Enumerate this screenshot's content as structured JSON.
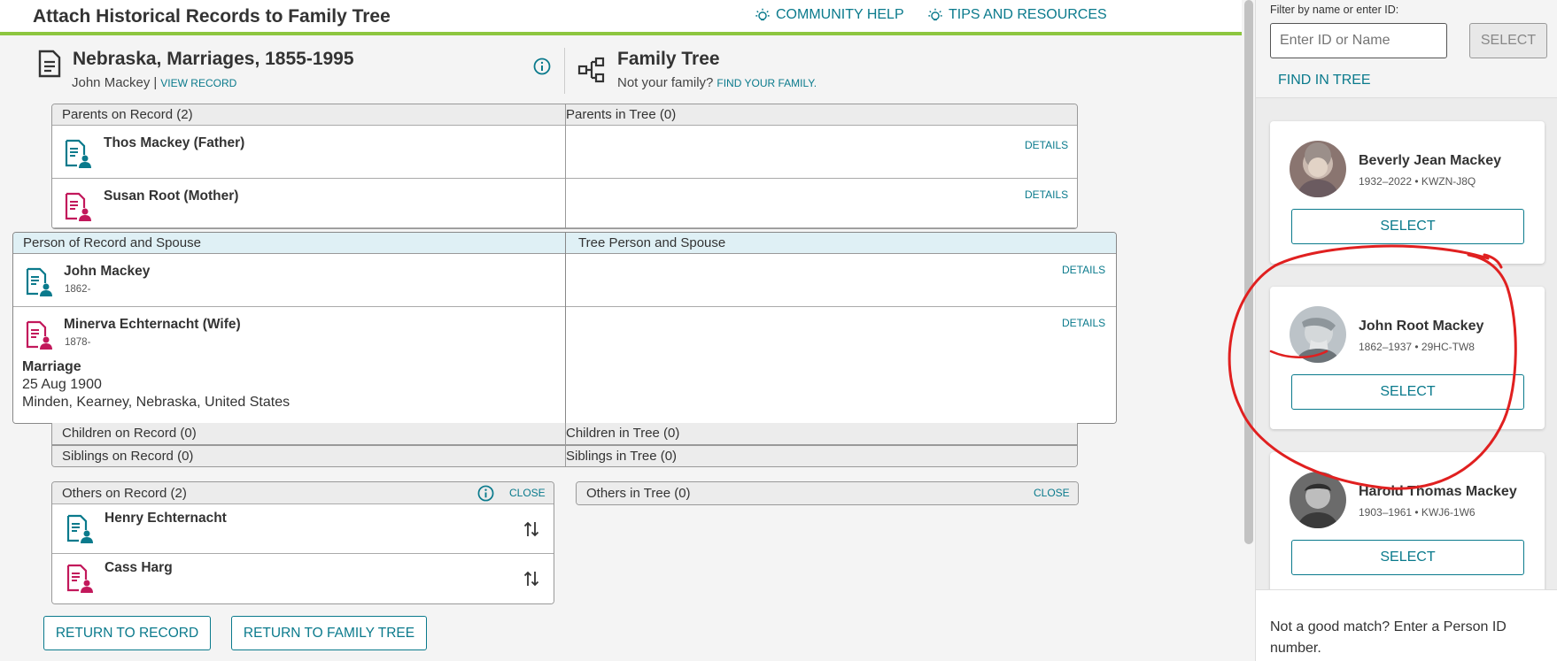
{
  "header": {
    "title": "Attach Historical Records to Family Tree",
    "community_help": "COMMUNITY HELP",
    "tips": "TIPS AND RESOURCES"
  },
  "record": {
    "title": "Nebraska, Marriages, 1855-1995",
    "person": "John Mackey",
    "separator": "|",
    "view_record": "VIEW RECORD"
  },
  "tree": {
    "title": "Family Tree",
    "question": "Not your family?",
    "find_family": "FIND YOUR FAMILY."
  },
  "parents": {
    "record_header": "Parents on Record (2)",
    "tree_header": "Parents in Tree (0)",
    "rows": [
      {
        "name": "Thos Mackey (Father)",
        "details": "DETAILS",
        "gender": "male"
      },
      {
        "name": "Susan Root (Mother)",
        "details": "DETAILS",
        "gender": "female"
      }
    ]
  },
  "couple": {
    "record_header": "Person of Record and Spouse",
    "tree_header": "Tree Person and Spouse",
    "rows": [
      {
        "name": "John Mackey",
        "dates": "1862-",
        "details": "DETAILS",
        "gender": "male"
      },
      {
        "name": "Minerva Echternacht (Wife)",
        "dates": "1878-",
        "details": "DETAILS",
        "gender": "female"
      }
    ],
    "event": {
      "type": "Marriage",
      "date": "25 Aug 1900",
      "place": "Minden, Kearney, Nebraska, United States"
    }
  },
  "children": {
    "record_header": "Children on Record (0)",
    "tree_header": "Children in Tree (0)"
  },
  "siblings": {
    "record_header": "Siblings on Record (0)",
    "tree_header": "Siblings in Tree (0)"
  },
  "others_record": {
    "header": "Others on Record (2)",
    "close": "CLOSE",
    "rows": [
      {
        "name": "Henry Echternacht",
        "gender": "male"
      },
      {
        "name": "Cass Harg",
        "gender": "female"
      }
    ]
  },
  "others_tree": {
    "header": "Others in Tree (0)",
    "close": "CLOSE"
  },
  "buttons": {
    "return_record": "RETURN TO RECORD",
    "return_tree": "RETURN TO FAMILY TREE"
  },
  "sidebar": {
    "filter_label": "Filter by name or enter ID:",
    "input_placeholder": "Enter ID or Name",
    "select_label": "SELECT",
    "find_in_tree": "FIND IN TREE",
    "candidates": [
      {
        "name": "Beverly Jean Mackey",
        "meta": "1932–2022 • KWZN-J8Q",
        "select": "SELECT"
      },
      {
        "name": "John Root Mackey",
        "meta": "1862–1937 • 29HC-TW8",
        "select": "SELECT"
      },
      {
        "name": "Harold Thomas Mackey",
        "meta": "1903–1961 • KWJ6-1W6",
        "select": "SELECT"
      }
    ],
    "not_good_match": "Not a good match? Enter a Person ID number."
  },
  "colors": {
    "accent": "#0a7a8c",
    "male_icon": "#0a7a8c",
    "female_icon": "#c2185b",
    "header_bar": "#8dc63f",
    "annotation": "#e02020"
  }
}
